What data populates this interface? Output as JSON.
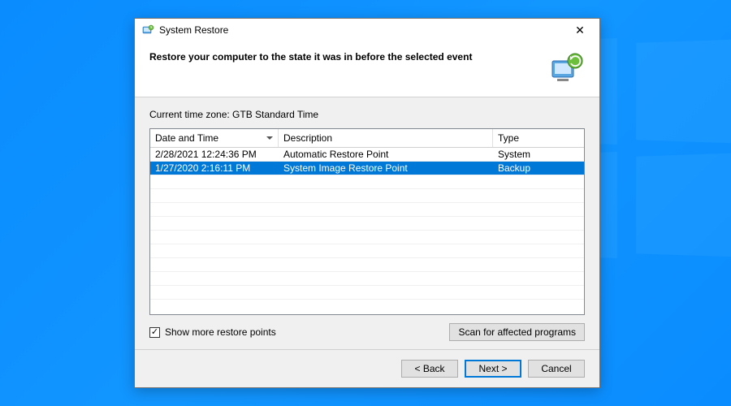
{
  "window": {
    "title": "System Restore",
    "close": "✕"
  },
  "header": {
    "heading": "Restore your computer to the state it was in before the selected event"
  },
  "content": {
    "timezone_label": "Current time zone: GTB Standard Time",
    "columns": {
      "date": "Date and Time",
      "desc": "Description",
      "type": "Type"
    },
    "rows": [
      {
        "date": "2/28/2021 12:24:36 PM",
        "desc": "Automatic Restore Point",
        "type": "System",
        "selected": false
      },
      {
        "date": "1/27/2020 2:16:11 PM",
        "desc": "System Image Restore Point",
        "type": "Backup",
        "selected": true
      }
    ],
    "checkbox": {
      "checked": true,
      "label": "Show more restore points"
    },
    "scan_button": "Scan for affected programs"
  },
  "footer": {
    "back": "< Back",
    "next": "Next >",
    "cancel": "Cancel"
  }
}
